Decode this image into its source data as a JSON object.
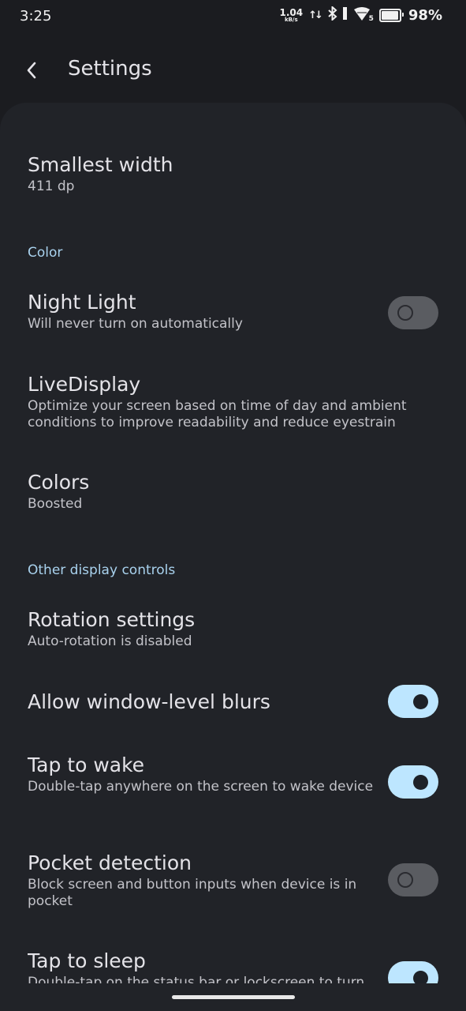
{
  "status_bar": {
    "time": "3:25",
    "net_speed_value": "1.04",
    "net_speed_unit": "kB/s",
    "network_type_badge": "5",
    "battery_percent": "98%",
    "battery_level": 0.98,
    "icons": [
      "upload-download-arrows-icon",
      "bluetooth-icon",
      "signal-bars-icon",
      "wifi-icon",
      "battery-icon"
    ]
  },
  "app_bar": {
    "title": "Settings",
    "back_icon": "chevron-left-icon"
  },
  "preferences": {
    "smallest_width": {
      "title": "Smallest width",
      "summary": "411 dp"
    },
    "color_header": "Color",
    "night_light": {
      "title": "Night Light",
      "summary": "Will never turn on automatically",
      "enabled": false
    },
    "live_display": {
      "title": "LiveDisplay",
      "summary": "Optimize your screen based on time of day and ambient conditions to improve readability and reduce eyestrain"
    },
    "colors": {
      "title": "Colors",
      "summary": "Boosted"
    },
    "other_header": "Other display controls",
    "rotation": {
      "title": "Rotation settings",
      "summary": "Auto-rotation is disabled"
    },
    "window_blurs": {
      "title": "Allow window-level blurs",
      "enabled": true
    },
    "tap_to_wake": {
      "title": "Tap to wake",
      "summary": "Double-tap anywhere on the screen to wake device",
      "enabled": true
    },
    "pocket_detection": {
      "title": "Pocket detection",
      "summary": "Block screen and button inputs when device is in pocket",
      "enabled": false
    },
    "tap_to_sleep": {
      "title": "Tap to sleep",
      "summary": "Double-tap on the status bar or lockscreen to turn",
      "enabled": true
    }
  },
  "colors": {
    "background": "#1b1c20",
    "panel": "#212328",
    "accent": "#a9d2ee",
    "switch_on": "#bde6ff",
    "switch_off": "#5a5c61"
  }
}
